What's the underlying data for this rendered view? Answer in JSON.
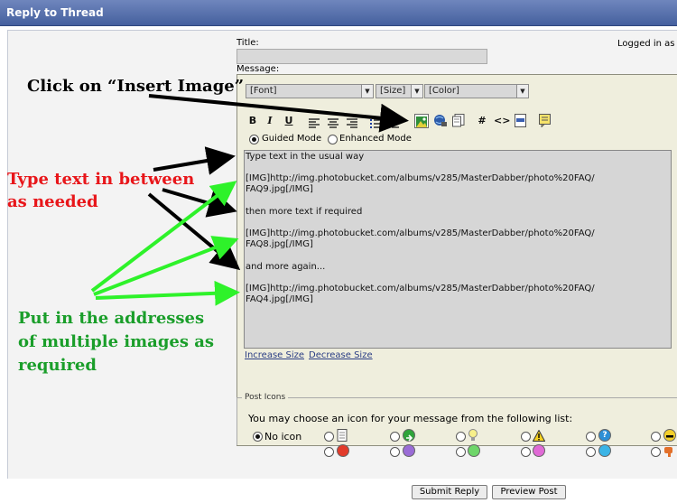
{
  "window": {
    "title": "Reply to Thread"
  },
  "form": {
    "title_label": "Title:",
    "message_label": "Message:",
    "logged_in": "Logged in as"
  },
  "toolbar": {
    "font": "[Font]",
    "size": "[Size]",
    "color": "[Color]",
    "bold": "B",
    "italic": "I",
    "underline": "U",
    "hash": "#",
    "code": "<>"
  },
  "modes": {
    "guided": "Guided Mode",
    "enhanced": "Enhanced Mode",
    "selected": "guided"
  },
  "message": {
    "lines": [
      "Type text in the usual way",
      "[IMG]http://img.photobucket.com/albums/v285/MasterDabber/photo%20FAQ/",
      "FAQ9.jpg[/IMG]",
      "then more text if required",
      "[IMG]http://img.photobucket.com/albums/v285/MasterDabber/photo%20FAQ/",
      "FAQ8.jpg[/IMG]",
      "and more again...",
      "[IMG]http://img.photobucket.com/albums/v285/MasterDabber/photo%20FAQ/",
      "FAQ4.jpg[/IMG]"
    ]
  },
  "resize": {
    "increase": "Increase Size",
    "decrease": "Decrease Size"
  },
  "post_icons": {
    "legend": "Post Icons",
    "prompt": "You may choose an icon for your message from the following list:",
    "no_icon": "No icon",
    "selected": "No icon"
  },
  "buttons": {
    "submit": "Submit Reply",
    "preview": "Preview Post"
  },
  "annotations": {
    "insert_image": "Click on “Insert Image”",
    "type_text_1": "Type text in between",
    "type_text_2": "as needed",
    "addresses_1": "Put in the addresses",
    "addresses_2": "of multiple images as",
    "addresses_3": "required"
  },
  "colors": {
    "titlebar": "#4f68a6",
    "annotation_red": "#e8161a",
    "annotation_green": "#1a9e2a",
    "arrow_green": "#2ef22a",
    "arrow_black": "#000000",
    "link": "#2a3d84"
  }
}
